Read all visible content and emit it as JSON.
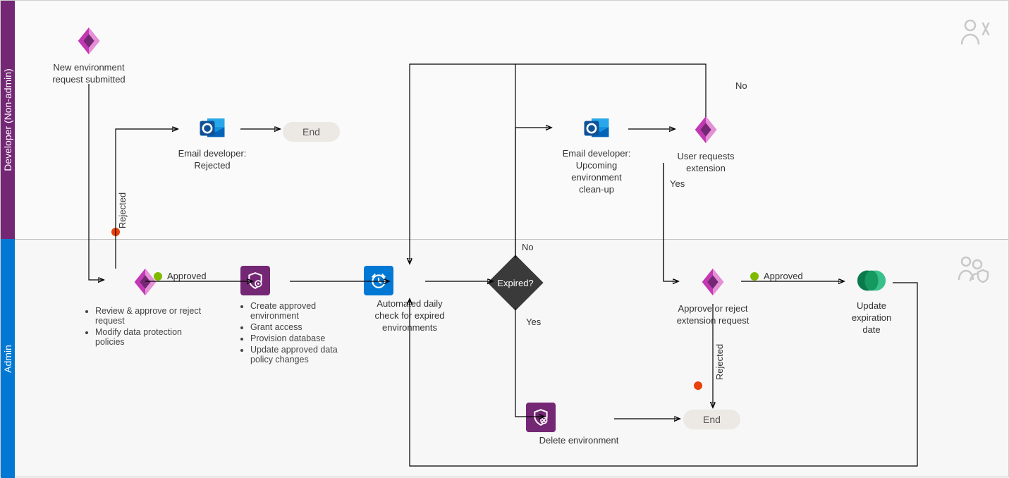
{
  "lanes": {
    "dev": "Developer (Non-admin)",
    "admin": "Admin"
  },
  "nodes": {
    "start": "New environment\nrequest submitted",
    "emailRej": "Email developer:\nRejected",
    "end1": "End",
    "review": {
      "b1": "Review & approve or reject request",
      "b2": "Modify data protection policies"
    },
    "create": {
      "b1": "Create approved environment",
      "b2": "Grant access",
      "b3": "Provision database",
      "b4": "Update approved data policy changes"
    },
    "dailyCheck": "Automated daily\ncheck for expired\nenvironments",
    "expired": "Expired?",
    "emailCleanup": "Email developer:\nUpcoming\nenvironment\nclean-up",
    "userReq": "User requests\nextension",
    "approveExt": "Approve or reject\nextension request",
    "updateExp": "Update\nexpiration\ndate",
    "deleteEnv": "Delete environment",
    "end2": "End"
  },
  "labels": {
    "approved": "Approved",
    "rejected": "Rejected",
    "yes": "Yes",
    "no": "No"
  }
}
